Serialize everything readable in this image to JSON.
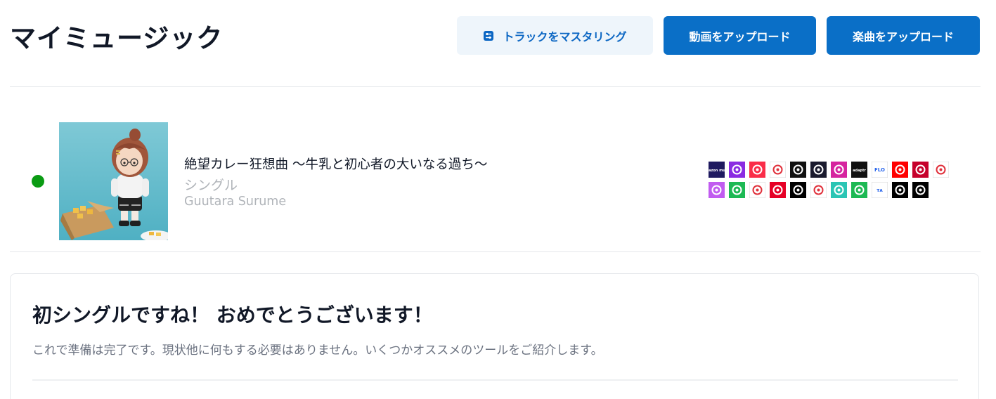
{
  "header": {
    "title": "マイミュージック",
    "master_button_label": "トラックをマスタリング",
    "upload_video_label": "動画をアップロード",
    "upload_music_label": "楽曲をアップロード"
  },
  "release": {
    "status_color": "#0a9b13",
    "title": "絶望カレー狂想曲 〜牛乳と初心者の大いなる過ち〜",
    "type": "シングル",
    "artist": "Guutara Surume",
    "stores": [
      {
        "name": "amazon-music",
        "color": "#1f1a60",
        "text": "amazon music"
      },
      {
        "name": "anghami",
        "color": "#8a2be2"
      },
      {
        "name": "apple-music",
        "color": "#fa2d48"
      },
      {
        "name": "mixcloud",
        "color": "#ffffff"
      },
      {
        "name": "boomplay",
        "color": "#111111"
      },
      {
        "name": "deezer",
        "color": "#1a1a2e"
      },
      {
        "name": "instagram",
        "color": "#d6249f"
      },
      {
        "name": "adaptr",
        "color": "#111111",
        "text": "adaptr"
      },
      {
        "name": "flo",
        "color": "#ffffff",
        "text": "FLO"
      },
      {
        "name": "youtube-music",
        "color": "#ff0000"
      },
      {
        "name": "iheartradio",
        "color": "#c6002b"
      },
      {
        "name": "kkbox",
        "color": "#ffffff"
      },
      {
        "name": "itunes",
        "color": "#c15cf0"
      },
      {
        "name": "joox",
        "color": "#1db954"
      },
      {
        "name": "soundcloud-like",
        "color": "#ffffff"
      },
      {
        "name": "netease",
        "color": "#e60026"
      },
      {
        "name": "qobuz",
        "color": "#000000"
      },
      {
        "name": "pandora",
        "color": "#ffffff"
      },
      {
        "name": "jiosaavn",
        "color": "#2bc5b4"
      },
      {
        "name": "spotify",
        "color": "#1db954"
      },
      {
        "name": "tidal-like",
        "color": "#ffffff",
        "text": "ᴛᴀ"
      },
      {
        "name": "tidal",
        "color": "#000000"
      },
      {
        "name": "tiktok",
        "color": "#010101"
      }
    ]
  },
  "card": {
    "title": "初シングルですね！ おめでとうございます！",
    "description": "これで準備は完了です。現状他に何もする必要はありません。いくつかオススメのツールをご紹介します。"
  }
}
